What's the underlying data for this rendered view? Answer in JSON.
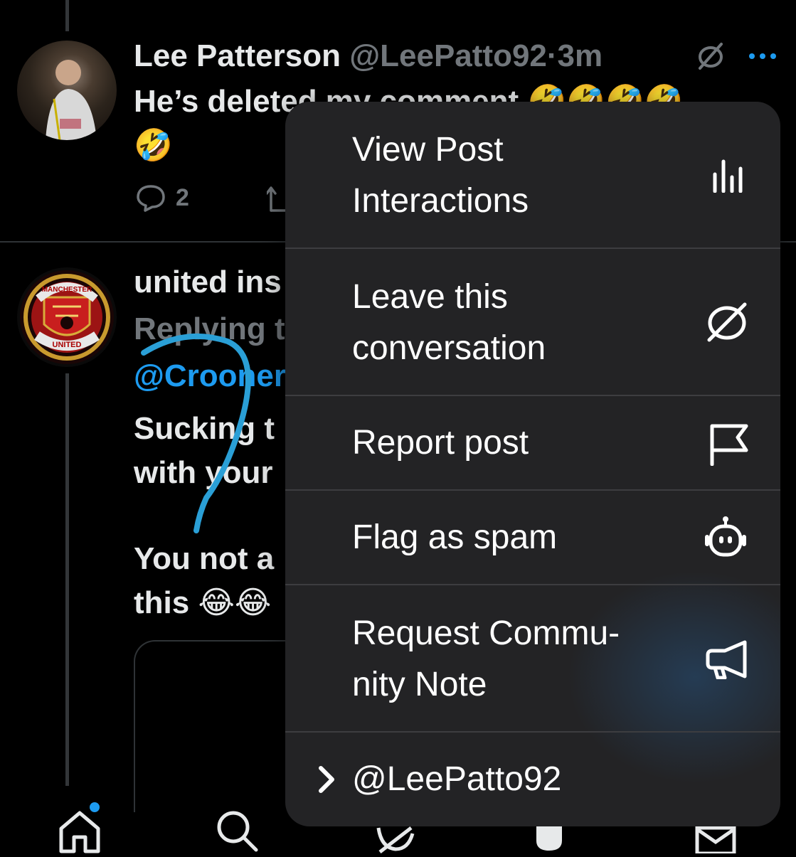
{
  "post1": {
    "display_name": "Lee Patterson",
    "handle": "@LeePatto92",
    "separator": "·",
    "time": "3m",
    "text_line1": "He’s deleted my comment 🤣🤣🤣🤣",
    "text_line2": "🤣",
    "reply_count": "2"
  },
  "post2": {
    "display_name": "united ins",
    "replying_label": "Replying t",
    "mention": "@Crooner",
    "line1": "Sucking t",
    "line2": "with your",
    "line3": "You not a",
    "line4": "this 😂😂",
    "avatar_top_text": "MANCHESTER",
    "avatar_bottom_text": "UNITED"
  },
  "menu": {
    "items": [
      {
        "line1": "View Post",
        "line2": "Interactions",
        "icon": "bar-chart-icon"
      },
      {
        "line1": "Leave this",
        "line2": "conversation",
        "icon": "mute-bubble-icon"
      },
      {
        "line1": "Report post",
        "icon": "flag-icon"
      },
      {
        "line1": "Flag as spam",
        "icon": "robot-icon"
      },
      {
        "line1": "Request Commu-",
        "line2": "nity Note",
        "icon": "megaphone-icon"
      }
    ],
    "account": "@LeePatto92"
  },
  "tabbar": {
    "items": [
      "home-icon",
      "search-icon",
      "grok-icon",
      "notifications-icon",
      "messages-icon"
    ]
  },
  "colors": {
    "accent": "#1d9bf0",
    "menu_bg": "#232325",
    "annotation": "#2a9fd6"
  }
}
